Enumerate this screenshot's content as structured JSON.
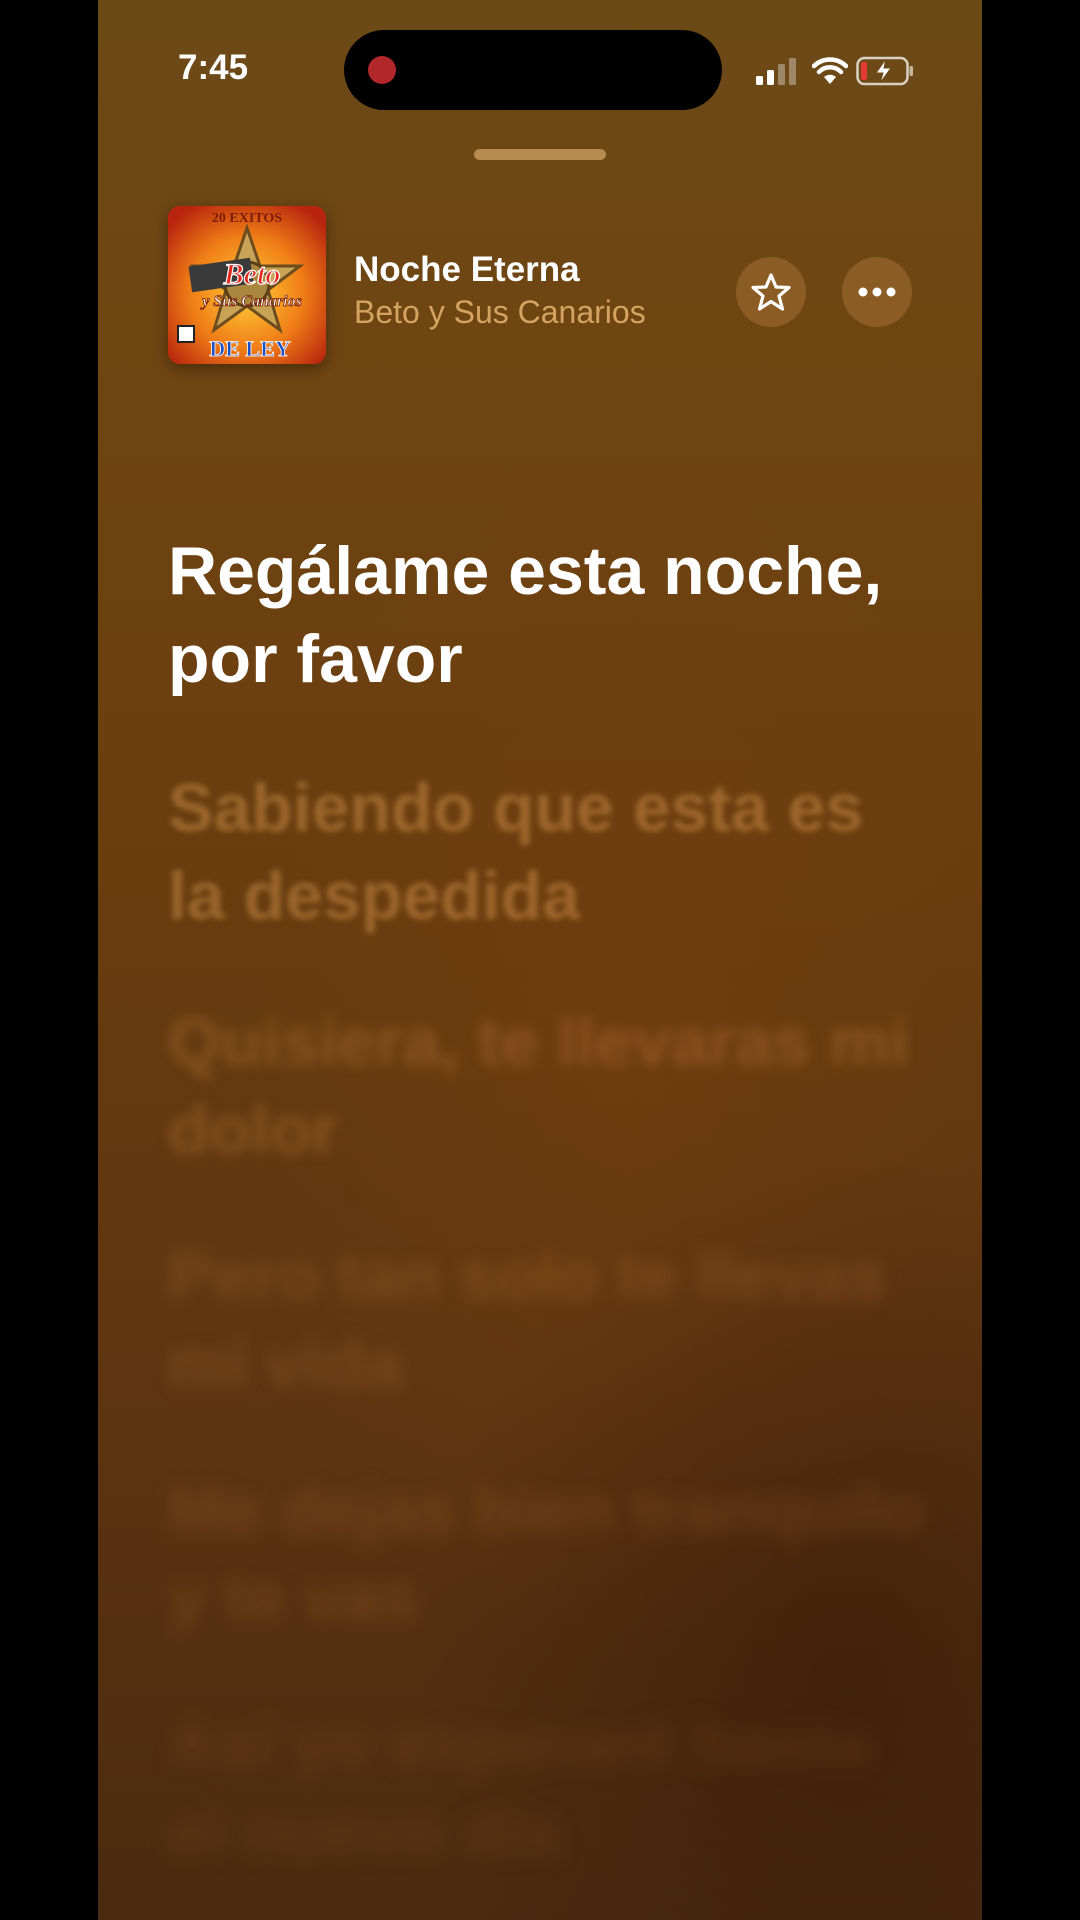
{
  "status_bar": {
    "time": "7:45",
    "icons": [
      "bell-slash-icon",
      "signal-icon",
      "wifi-icon",
      "battery-charging-icon"
    ],
    "recording_color": "#b3272b"
  },
  "now_playing": {
    "title": "Noche Eterna",
    "artist": "Beto y Sus Canarios",
    "artwork_text": {
      "top": "20 EXITOS",
      "main": "Beto",
      "sub": "y Sus Canarios",
      "bottom": "DE LEY"
    },
    "favorite_icon": "star-icon",
    "more_icon": "ellipsis-icon"
  },
  "lyrics": {
    "current_line": "Regálame esta noche, por favor",
    "upcoming": [
      "Sabiendo que esta es la despedida",
      "Quisiera, te llevaras mi dolor",
      "Pero tan solo te llevas mi vida",
      "Me dejas bien tranquilo y te vas",
      "Así yo esperaré hasta el nuevo día"
    ]
  },
  "colors": {
    "background": "#6a3d0f",
    "artist_text": "#e8b46e",
    "accent_button": "#af783c"
  }
}
